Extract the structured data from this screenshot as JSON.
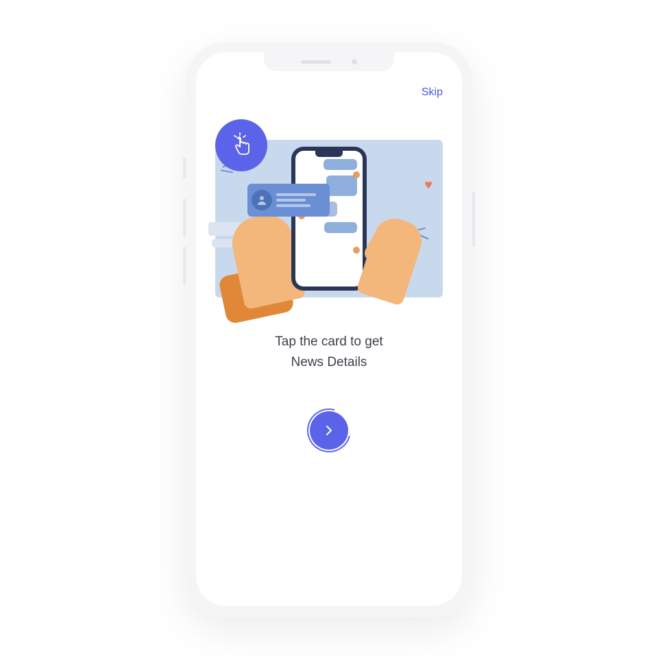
{
  "header": {
    "skip_label": "Skip"
  },
  "onboarding": {
    "instruction_line1": "Tap the card to get",
    "instruction_line2": "News Details"
  },
  "icons": {
    "tap": "tap-gesture-icon",
    "next": "chevron-right-icon",
    "heart": "heart-icon"
  },
  "colors": {
    "accent": "#5b63e8",
    "illustration_bg": "#c9d9ed",
    "skin": "#f3b77c",
    "sleeve": "#e08838"
  }
}
